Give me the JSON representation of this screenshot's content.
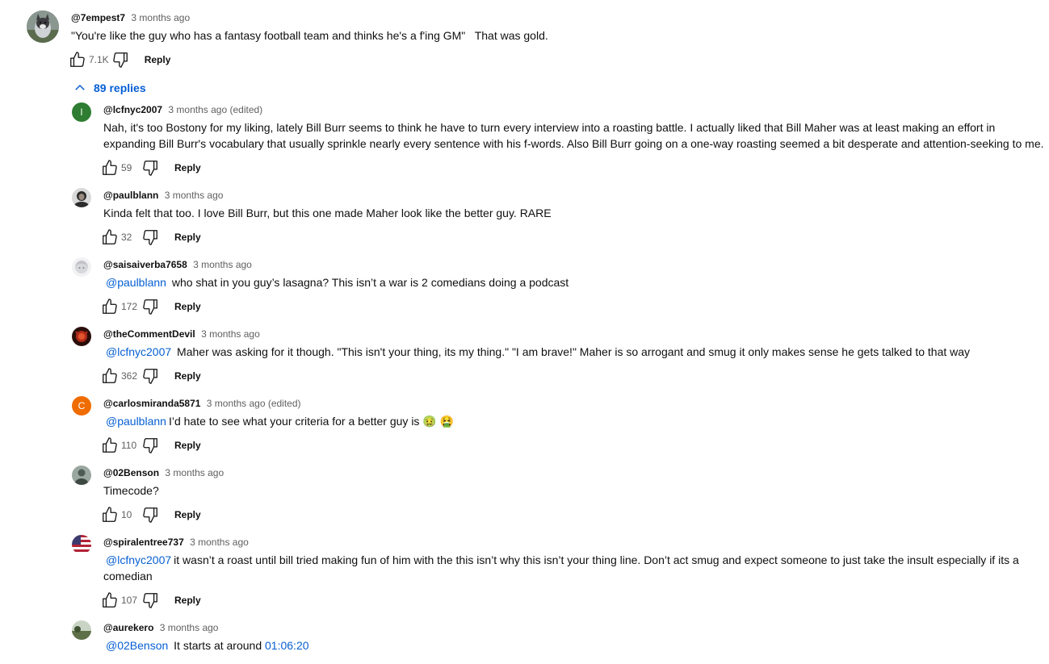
{
  "top_comment": {
    "author": "@7empest7",
    "time": "3 months ago",
    "text": "\"You're like the guy who has a fantasy football team and thinks he's a f'ing GM\"   That was gold.",
    "likes": "7.1K",
    "reply_label": "Reply"
  },
  "replies_toggle": {
    "label": "89 replies"
  },
  "replies": [
    {
      "author": "@lcfnyc2007",
      "time": "3 months ago (edited)",
      "mention": "",
      "text": "Nah, it's too Bostony for my liking, lately Bill Burr seems to think he have to turn every interview into a roasting battle. I actually liked that Bill Maher was at least making an effort in expanding Bill Burr's vocabulary that usually sprinkle nearly every sentence with his f-words. Also Bill Burr going on a one-way roasting seemed a bit desperate and attention-seeking to me.",
      "likes": "59",
      "reply_label": "Reply",
      "avatar_letter": "l",
      "avatar_color": "#2e7d32"
    },
    {
      "author": "@paulblann",
      "time": "3 months ago",
      "mention": "",
      "text": "Kinda felt that too. I love Bill Burr, but this one made Maher look like the better guy. RARE",
      "likes": "32",
      "reply_label": "Reply",
      "avatar_color": "#3a3a3a"
    },
    {
      "author": "@saisaiverba7658",
      "time": "3 months ago",
      "mention": "@paulblann",
      "text": " who shat in you guy’s lasagna? This isn’t a war is 2 comedians doing a podcast",
      "likes": "172",
      "reply_label": "Reply",
      "avatar_color": "#e6e6ea"
    },
    {
      "author": "@theCommentDevil",
      "time": "3 months ago",
      "mention": "@lcfnyc2007",
      "text": " Maher was asking for it though. \"This isn't your thing, its my thing.\" \"I am brave!\" Maher is so arrogant and smug it only makes sense he gets talked to that way",
      "likes": "362",
      "reply_label": "Reply",
      "avatar_color": "#5a1a12"
    },
    {
      "author": "@carlosmiranda5871",
      "time": "3 months ago (edited)",
      "mention": "@paulblann",
      "text": "I’d hate to see what your criteria for a better guy is 🤢 🤮",
      "likes": "110",
      "reply_label": "Reply",
      "avatar_letter": "C",
      "avatar_color": "#ef6c00"
    },
    {
      "author": "@02Benson",
      "time": "3 months ago",
      "mention": "",
      "text": "Timecode?",
      "likes": "10",
      "reply_label": "Reply",
      "avatar_color": "#6d7b72"
    },
    {
      "author": "@spiralentree737",
      "time": "3 months ago",
      "mention": "@lcfnyc2007",
      "text": "it wasn’t a roast until bill tried making fun of him with the this isn’t why this isn’t your thing line. Don’t act smug and expect someone to just take the insult especially if its a comedian",
      "likes": "107",
      "reply_label": "Reply",
      "avatar_color": "#b22234"
    },
    {
      "author": "@aurekero",
      "time": "3 months ago",
      "mention": "@02Benson",
      "text": " It starts at around ",
      "timestamp_link": "01:06:20",
      "likes": "",
      "reply_label": "",
      "avatar_color": "#7c8c6a"
    }
  ]
}
